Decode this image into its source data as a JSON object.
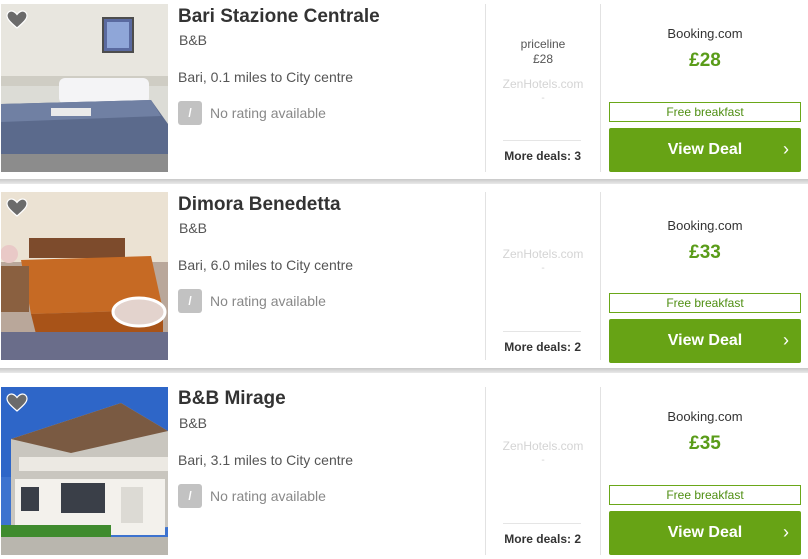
{
  "colors": {
    "accent": "#67a315",
    "price": "#5a9c19",
    "badge": "#c2c2c2"
  },
  "icons": {
    "heart": "heart-outline-icon",
    "chevron": "chevron-right-icon"
  },
  "hotels": [
    {
      "name": "Bari Stazione Centrale",
      "type": "B&B",
      "distance": "Bari, 0.1 miles to City centre",
      "rating_badge": "/",
      "rating_text": "No rating available",
      "provider1": "priceline",
      "provider1_price": "£28",
      "provider2": "ZenHotels.com",
      "provider2_price": "-",
      "more_deals": "More deals: 3",
      "best_provider": "Booking.com",
      "best_price": "£28",
      "perk": "Free breakfast",
      "cta": "View Deal",
      "cta_arrow": "›"
    },
    {
      "name": "Dimora Benedetta",
      "type": "B&B",
      "distance": "Bari, 6.0 miles to City centre",
      "rating_badge": "/",
      "rating_text": "No rating available",
      "provider2": "ZenHotels.com",
      "provider2_price": "-",
      "more_deals": "More deals: 2",
      "best_provider": "Booking.com",
      "best_price": "£33",
      "perk": "Free breakfast",
      "cta": "View Deal",
      "cta_arrow": "›"
    },
    {
      "name": "B&B Mirage",
      "type": "B&B",
      "distance": "Bari, 3.1 miles to City centre",
      "rating_badge": "/",
      "rating_text": "No rating available",
      "provider2": "ZenHotels.com",
      "provider2_price": "-",
      "more_deals": "More deals: 2",
      "best_provider": "Booking.com",
      "best_price": "£35",
      "perk": "Free breakfast",
      "cta": "View Deal",
      "cta_arrow": "›"
    }
  ]
}
